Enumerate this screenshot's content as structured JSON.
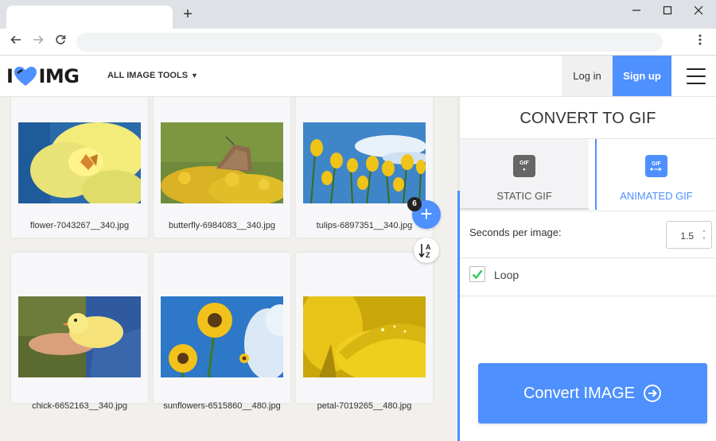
{
  "browser": {
    "tab_title": "",
    "new_tab_symbol": "+",
    "address_value": ""
  },
  "header": {
    "logo": {
      "left": "I",
      "right": "IMG"
    },
    "all_tools": "ALL IMAGE TOOLS",
    "login": "Log in",
    "signup": "Sign up"
  },
  "files": [
    {
      "name": "flower-7043267__340.jpg",
      "thumbnail": "yellow-flower"
    },
    {
      "name": "butterfly-6984083__340.jpg",
      "thumbnail": "butterfly"
    },
    {
      "name": "tulips-6897351__340.jpg",
      "thumbnail": "tulips"
    },
    {
      "name": "chick-6652163__340.jpg",
      "thumbnail": "chick"
    },
    {
      "name": "sunflowers-6515860__480.jpg",
      "thumbnail": "sunflowers"
    },
    {
      "name": "petal-7019265__480.jpg",
      "thumbnail": "petal"
    }
  ],
  "workspace": {
    "file_count": "6",
    "add_symbol": "+"
  },
  "sidebar": {
    "title": "CONVERT TO GIF",
    "static_gif": {
      "label": "STATIC GIF",
      "icon_text": "GIF"
    },
    "animated_gif": {
      "label": "ANIMATED GIF",
      "icon_text": "GIF"
    },
    "seconds_label": "Seconds per image:",
    "seconds_value": "1.5",
    "loop_label": "Loop",
    "loop_checked": true,
    "convert_label": "Convert IMAGE"
  },
  "colors": {
    "accent": "#4d90fe",
    "check": "#35c759",
    "workspace_bg": "#f2f0ec"
  }
}
